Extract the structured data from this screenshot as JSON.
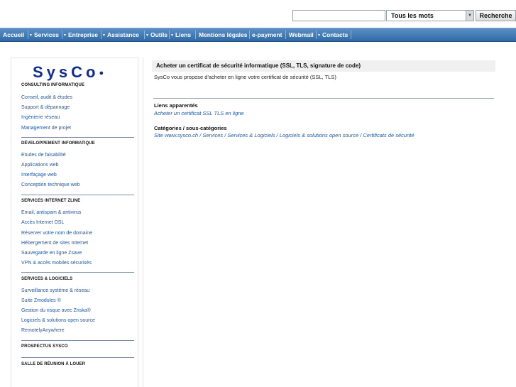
{
  "search": {
    "value": "",
    "mode": "Tous les mots",
    "button_label": "Recherche"
  },
  "nav": [
    {
      "label": "Accueil",
      "arrow": false
    },
    {
      "label": "Services",
      "arrow": true
    },
    {
      "label": "Entreprise",
      "arrow": true
    },
    {
      "label": "Assistance",
      "arrow": true
    },
    {
      "label": "Outils",
      "arrow": true
    },
    {
      "label": "Liens",
      "arrow": true
    },
    {
      "label": "Mentions légales",
      "arrow": false
    },
    {
      "label": "e-payment",
      "arrow": false
    },
    {
      "label": "Webmail",
      "arrow": false
    },
    {
      "label": "Contacts",
      "arrow": true
    }
  ],
  "sidebar": {
    "logo": "SysCo",
    "sections": [
      {
        "title": "Consulting informatique",
        "links": [
          "Conseil, audit & études",
          "Support & dépannage",
          "Ingénierie réseau",
          "Management de projet"
        ]
      },
      {
        "title": "Développement informatique",
        "links": [
          "Etudes de faisabilité",
          "Applications web",
          "Interfaçage web",
          "Conception technique web"
        ]
      },
      {
        "title": "Services Internet Zline",
        "links": [
          "Email, antispam & antivirus",
          "Accès Internet DSL",
          "Réserver votre nom de domaine",
          "Hébergement de sites Internet",
          "Sauvegarde en ligne Zsave",
          "VPN & accès mobiles sécurisés"
        ]
      },
      {
        "title": "Services & Logiciels",
        "links": [
          "Surveillance système & réseau",
          "Suite Zmodules ®",
          "Gestion du risque avec Zriska®",
          "Logiciels & solutions open source",
          "RemotelyAnywhere"
        ]
      },
      {
        "title": "Prospectus SysCo",
        "links": []
      },
      {
        "title": "Salle de réunion à louer",
        "links": []
      }
    ]
  },
  "main": {
    "title": "Acheter un certificat de sécurité informatique (SSL, TLS, signature de code)",
    "intro": "SysCo vous propose d'acheter en ligne votre certificat de sécurité (SSL, TLS)",
    "related_heading": "Liens apparentés",
    "related_link": "Acheter un certificat SSL TLS en ligne",
    "categories_heading": "Catégories / sous-catégories",
    "breadcrumb": [
      "Site www.sysco.ch",
      "Services",
      "Services & Logiciels",
      "Logiciels & solutions open source",
      "Certificats de sécurité"
    ]
  },
  "colors": {
    "nav_background": "#2f6aa8",
    "link": "#1f58a6",
    "logo": "#0f2d8f"
  }
}
